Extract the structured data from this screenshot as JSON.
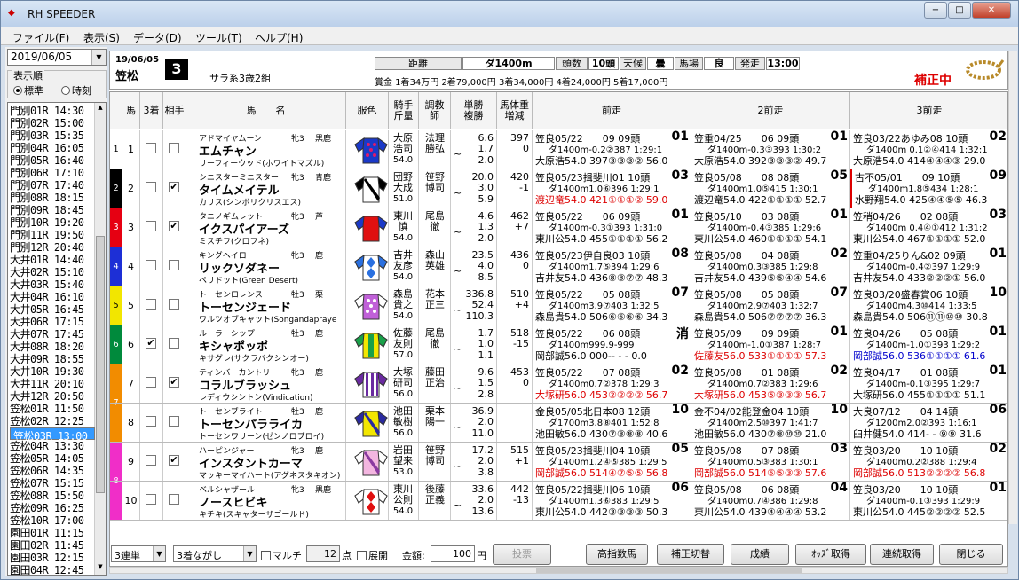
{
  "window": {
    "title": "RH SPEEDER",
    "minimize": "−",
    "maximize": "□",
    "close": "✕"
  },
  "menu": [
    "ファイル(F)",
    "表示(S)",
    "データ(D)",
    "ツール(T)",
    "ヘルプ(H)"
  ],
  "sidebar": {
    "date": "2019/06/05",
    "display_order_label": "表示順",
    "radio_standard": "標準",
    "radio_time": "時刻",
    "races": [
      "門別01R 14:30",
      "門別02R 15:00",
      "門別03R 15:35",
      "門別04R 16:05",
      "門別05R 16:40",
      "門別06R 17:10",
      "門別07R 17:40",
      "門別08R 18:15",
      "門別09R 18:45",
      "門別10R 19:20",
      "門別11R 19:50",
      "門別12R 20:40",
      "大井01R 14:40",
      "大井02R 15:10",
      "大井03R 15:40",
      "大井04R 16:10",
      "大井05R 16:45",
      "大井06R 17:15",
      "大井07R 17:45",
      "大井08R 18:20",
      "大井09R 18:55",
      "大井10R 19:30",
      "大井11R 20:10",
      "大井12R 20:50",
      "笠松01R 11:50",
      "笠松02R 12:25",
      "笠松03R 13:00",
      "笠松04R 13:30",
      "笠松05R 14:05",
      "笠松06R 14:35",
      "笠松07R 15:15",
      "笠松08R 15:50",
      "笠松09R 16:25",
      "笠松10R 17:00",
      "園田01R 11:15",
      "園田02R 11:45",
      "園田03R 12:15",
      "園田04R 12:45"
    ],
    "selected_index": 26
  },
  "race": {
    "date": "19/06/05",
    "track": "笠松",
    "number": "3",
    "class": "サラ系3歳2組",
    "dist_label": "距離",
    "dist": "ダ1400m",
    "heads_label": "頭数",
    "heads": "10頭",
    "weather_label": "天候",
    "weather": "曇",
    "going_label": "馬場",
    "going": "良",
    "start_label": "発走",
    "start": "13:00",
    "prize": "賞金 1着34万円 2着79,000円 3着34,000円 4着24,000円 5着17,000円",
    "correction": "補正中"
  },
  "columns": {
    "uma": "馬",
    "third": "3着",
    "partner": "相手",
    "name": "馬　　名",
    "color": "服色",
    "jockey": "騎手斤量",
    "trainer": "調教師",
    "odds": "単勝複勝",
    "weight": "馬体重増減",
    "p1": "前走",
    "p2": "2前走",
    "p3": "3前走"
  },
  "horses": [
    {
      "waku": "1",
      "num": "1",
      "third": false,
      "partner": false,
      "sire": "アドマイヤムーン",
      "sex": "牝3",
      "coat": "黒鹿",
      "name": "エムチャン",
      "dam": "リーフィーウッド(ホワイトマズル)",
      "jockey": "大原",
      "jockey2": "浩司",
      "kin": "54.0",
      "trainer": "法理",
      "trainer2": "勝弘",
      "odds": "6.6",
      "place_low": "1.7",
      "place_high": "2.0",
      "bw": "397",
      "bwd": "0",
      "p1": {
        "a": "笠良05/22　　09 09頭",
        "rk": "01",
        "b": "ダ1400m-0.2②387 1:29:1",
        "c": "大原浩54.0 397③③③② 56.0"
      },
      "p2": {
        "a": "笠重04/25　　06 09頭",
        "rk": "01",
        "b": "ダ1400m-0.3③393 1:30:2",
        "c": "大原浩54.0 392③③③② 49.7"
      },
      "p3": {
        "a": "笠良03/22あゆみ08 10頭",
        "rk": "02",
        "b": "ダ1400m 0.1②④414 1:32:1",
        "c": "大原浩54.0 414④④④③ 29.0"
      }
    },
    {
      "waku": "2",
      "num": "2",
      "third": false,
      "partner": true,
      "sire": "シニスターミニスター",
      "sex": "牝3",
      "coat": "青鹿",
      "name": "タイムメイテル",
      "dam": "カリス(シンボリクリスエス)",
      "jockey": "団野",
      "jockey2": "大成",
      "kin": "51.0",
      "trainer": "笹野",
      "trainer2": "博司",
      "odds": "20.0",
      "place_low": "3.0",
      "place_high": "5.9",
      "bw": "420",
      "bwd": "-1",
      "p1": {
        "a": "笠良05/23揖斐川01 10頭",
        "rk": "03",
        "b": "ダ1400m1.0⑥396 1:29:1",
        "c": "渡辺竜54.0 421①①①② 59.0"
      },
      "p2": {
        "a": "笠良05/08　　08 08頭",
        "rk": "05",
        "b": "ダ1400m1.0⑤415 1:30:1",
        "c": "渡辺竜54.0 422①①①① 52.7"
      },
      "p3": {
        "a": "古不05/01　　09 10頭",
        "rk": "09",
        "b": "ダ1400m1.8⑤434 1:28:1",
        "c": "水野翔54.0 425④④⑤⑤ 46.3"
      }
    },
    {
      "waku": "3",
      "num": "3",
      "third": false,
      "partner": true,
      "sire": "タニノギムレット",
      "sex": "牝3",
      "coat": "芦",
      "name": "イクスパイアーズ",
      "dam": "ミスチフ(クロフネ)",
      "jockey": "東川",
      "jockey2": "慎",
      "kin": "54.0",
      "trainer": "尾島",
      "trainer2": "徹",
      "odds": "4.6",
      "place_low": "1.3",
      "place_high": "2.0",
      "bw": "462",
      "bwd": "+7",
      "p1": {
        "a": "笠良05/22　　06 09頭",
        "rk": "01",
        "b": "ダ1400m-0.3①393 1:31:0",
        "c": "東川公54.0 455①①①① 56.2"
      },
      "p2": {
        "a": "笠良05/10　　03 08頭",
        "rk": "01",
        "b": "ダ1400m-0.4③385 1:29:6",
        "c": "東川公54.0 460①①①① 54.1"
      },
      "p3": {
        "a": "笠稍04/26　　02 08頭",
        "rk": "03",
        "b": "ダ1400m 0.4④①412 1:31:2",
        "c": "東川公54.0 467①①①① 52.0"
      }
    },
    {
      "waku": "4",
      "num": "4",
      "third": false,
      "partner": false,
      "sire": "キングヘイロー",
      "sex": "牝3",
      "coat": "鹿",
      "name": "リックソダネー",
      "dam": "ペリドット(Green Desert)",
      "jockey": "吉井",
      "jockey2": "友彦",
      "kin": "54.0",
      "trainer": "森山",
      "trainer2": "英雄",
      "odds": "23.5",
      "place_low": "4.0",
      "place_high": "8.5",
      "bw": "436",
      "bwd": "0",
      "p1": {
        "a": "笠良05/23伊自良03 10頭",
        "rk": "08",
        "b": "ダ1400m1.7⑤394 1:29:6",
        "c": "吉井友54.0 436⑧⑧⑦⑦ 48.3"
      },
      "p2": {
        "a": "笠良05/08　　04 08頭",
        "rk": "02",
        "b": "ダ1400m0.3③385 1:29:8",
        "c": "吉井友54.0 439⑤⑤④④ 54.6"
      },
      "p3": {
        "a": "笠重04/25りん&02 09頭",
        "rk": "01",
        "b": "ダ1400m-0.4②397 1:29:9",
        "c": "吉井友54.0 433②②②① 56.0"
      }
    },
    {
      "waku": "5",
      "num": "5",
      "third": false,
      "partner": false,
      "sire": "トーセンロレンス",
      "sex": "牡3",
      "coat": "栗",
      "name": "トーセンジェード",
      "dam": "ワルツオブキャット(Songandapraye",
      "jockey": "森島",
      "jockey2": "貴之",
      "kin": "54.0",
      "trainer": "花本",
      "trainer2": "正三",
      "odds": "336.8",
      "place_low": "52.4",
      "place_high": "110.3",
      "bw": "510",
      "bwd": "+4",
      "p1": {
        "a": "笠良05/22　　05 08頭",
        "rk": "07",
        "b": "ダ1400m3.9⑦403 1:32:5",
        "c": "森島貴54.0 506⑥⑥⑥⑥ 34.3"
      },
      "p2": {
        "a": "笠良05/08　　05 08頭",
        "rk": "07",
        "b": "ダ1400m2.9⑦403 1:32:7",
        "c": "森島貴54.0 506⑦⑦⑦⑦ 36.3"
      },
      "p3": {
        "a": "笠良03/20盛春賞06 10頭",
        "rk": "10",
        "b": "ダ1400m4.3⑩414 1:33:5",
        "c": "森島貴54.0 506⑪⑪⑩⑩ 30.8"
      }
    },
    {
      "waku": "6",
      "num": "6",
      "third": true,
      "partner": false,
      "sire": "ルーラーシップ",
      "sex": "牡3",
      "coat": "鹿",
      "name": "キシャポッポ",
      "dam": "キサグレ(サクラバクシンオー)",
      "jockey": "佐藤",
      "jockey2": "友則",
      "kin": "57.0",
      "trainer": "尾島",
      "trainer2": "徹",
      "odds": "1.7",
      "place_low": "1.0",
      "place_high": "1.1",
      "bw": "518",
      "bwd": "-15",
      "p1": {
        "a": "笠良05/22　　06 08頭",
        "rk": "消",
        "b": "ダ1400m999.9-999",
        "c": "岡部誠56.0 000-- - - 0.0"
      },
      "p2": {
        "a": "笠良05/09　　09 09頭",
        "rk": "01",
        "b": "ダ1400m-1.0①387 1:28:7",
        "c": "佐藤友56.0 533①①①① 57.3"
      },
      "p3": {
        "a": "笠良04/26　　05 08頭",
        "rk": "01",
        "b": "ダ1400m-1.0①393 1:29:2",
        "c": "岡部誠56.0 536①①①① 61.6"
      }
    },
    {
      "waku": "7",
      "num": "7",
      "third": false,
      "partner": true,
      "sire": "ティンバーカントリー",
      "sex": "牝3",
      "coat": "鹿",
      "name": "コラルブラッシュ",
      "dam": "レディウシントン(Vindication)",
      "jockey": "大塚",
      "jockey2": "研司",
      "kin": "56.0",
      "trainer": "藤田",
      "trainer2": "正治",
      "odds": "9.6",
      "place_low": "1.5",
      "place_high": "2.8",
      "bw": "453",
      "bwd": "0",
      "p1": {
        "a": "笠良05/22　　07 08頭",
        "rk": "02",
        "b": "ダ1400m0.7②378 1:29:3",
        "c": "大塚研56.0 453②②②② 56.7"
      },
      "p2": {
        "a": "笠良05/08　　01 08頭",
        "rk": "02",
        "b": "ダ1400m0.7②383 1:29:6",
        "c": "大塚研56.0 453⑤③③③ 56.7"
      },
      "p3": {
        "a": "笠良04/17　　01 08頭",
        "rk": "01",
        "b": "ダ1400m-0.1③395 1:29:7",
        "c": "大塚研56.0 455①①①① 51.1"
      }
    },
    {
      "waku": "7",
      "num": "8",
      "third": false,
      "partner": false,
      "sire": "トーセンブライト",
      "sex": "牡3",
      "coat": "鹿",
      "name": "トーセンパラライカ",
      "dam": "トーセンワリーン(ゼンノロブロイ)",
      "jockey": "池田",
      "jockey2": "敏樹",
      "kin": "56.0",
      "trainer": "栗本",
      "trainer2": "陽一",
      "odds": "36.9",
      "place_low": "2.0",
      "place_high": "11.0",
      "bw": "",
      "bwd": "",
      "p1": {
        "a": "金良05/05北日本08 12頭",
        "rk": "10",
        "b": "ダ1700m3.8⑧401 1:52:8",
        "c": "池田敏56.0 430⑦⑧⑧⑧ 40.6"
      },
      "p2": {
        "a": "金不04/02能登金04 10頭",
        "rk": "10",
        "b": "ダ1400m2.5⑩397 1:41:7",
        "c": "池田敏56.0 430⑦⑧⑩⑩ 21.0"
      },
      "p3": {
        "a": "大良07/12　　04 14頭",
        "rk": "06",
        "b": "ダ1200m2.0②393 1:16:1",
        "c": "臼井健54.0 414- - ⑨⑨ 31.6"
      }
    },
    {
      "waku": "8",
      "num": "9",
      "third": false,
      "partner": true,
      "sire": "ハーピンジャー",
      "sex": "牝3",
      "coat": "鹿",
      "name": "インスタントカーマ",
      "dam": "マッキーマイハート(アグネスタキオン)",
      "jockey": "岩田",
      "jockey2": "望来",
      "kin": "53.0",
      "trainer": "笹野",
      "trainer2": "博司",
      "odds": "17.2",
      "place_low": "2.0",
      "place_high": "3.8",
      "bw": "515",
      "bwd": "+1",
      "p1": {
        "a": "笠良05/23揖斐川04 10頭",
        "rk": "05",
        "b": "ダ1400m1.2④⑤385 1:29:5",
        "c": "岡部誠56.0 514④⑦⑤⑤ 56.8"
      },
      "p2": {
        "a": "笠良05/08　　07 08頭",
        "rk": "03",
        "b": "ダ1400m0.5③383 1:30:1",
        "c": "岡部誠56.0 514⑥⑤③③ 57.6"
      },
      "p3": {
        "a": "笠良03/20　　10 10頭",
        "rk": "02",
        "b": "ダ1400m0.2②388 1:29:4",
        "c": "岡部誠56.0 513②②②② 56.8"
      }
    },
    {
      "waku": "8",
      "num": "10",
      "third": false,
      "partner": false,
      "sire": "ベルシャザール",
      "sex": "牝3",
      "coat": "黒鹿",
      "name": "ノースヒビキ",
      "dam": "キチキ(スキャターザゴールド)",
      "jockey": "東川",
      "jockey2": "公則",
      "kin": "54.0",
      "trainer": "後藤",
      "trainer2": "正義",
      "odds": "33.6",
      "place_low": "2.0",
      "place_high": "13.6",
      "bw": "442",
      "bwd": "-13",
      "p1": {
        "a": "笠良05/22揖斐川06 10頭",
        "rk": "06",
        "b": "ダ1400m1.3⑥383 1:29:5",
        "c": "東川公54.0 442③③③③ 50.3"
      },
      "p2": {
        "a": "笠良05/08　　06 08頭",
        "rk": "04",
        "b": "ダ1400m0.7④386 1:29:8",
        "c": "東川公54.0 439④④④④ 53.2"
      },
      "p3": {
        "a": "笠良03/20　　10 10頭",
        "rk": "01",
        "b": "ダ1400m-0.1③393 1:29:9",
        "c": "東川公54.0 445②②②② 52.5"
      }
    }
  ],
  "bottom": {
    "bet_type": "3連単",
    "bet_method": "3着ながし",
    "multi": "マルチ",
    "points": "12",
    "points_unit": "点",
    "expand": "展開",
    "amount_label": "金額:",
    "amount": "100",
    "amount_unit": "円",
    "vote": "投票",
    "btn_high": "高指数馬",
    "btn_corr": "補正切替",
    "btn_result": "成績",
    "btn_odds": "ｵｯｽﾞ取得",
    "btn_cont": "連続取得",
    "btn_close": "閉じる"
  },
  "colors": {
    "waku": [
      "#ffffff",
      "#000000",
      "#e60012",
      "#1d2fd6",
      "#f2e600",
      "#008a3c",
      "#f28c00",
      "#f02ec8"
    ],
    "selection": "#3399ff",
    "correction": "#d00000"
  }
}
